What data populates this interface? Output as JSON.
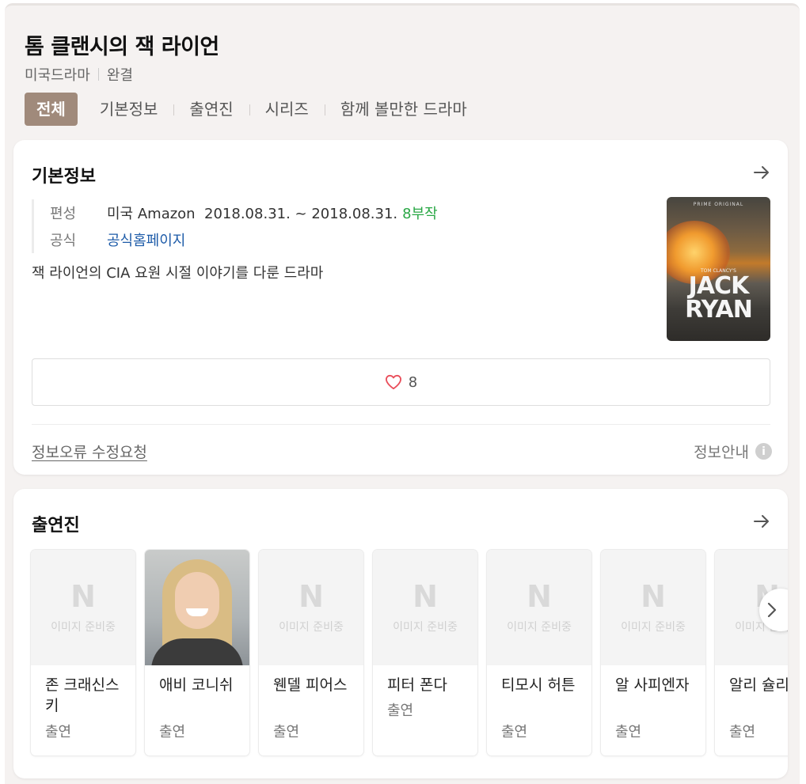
{
  "header": {
    "title": "톰 클랜시의 잭 라이언",
    "genre": "미국드라마",
    "status": "완결"
  },
  "tabs": [
    {
      "label": "전체",
      "active": true
    },
    {
      "label": "기본정보"
    },
    {
      "label": "출연진"
    },
    {
      "label": "시리즈"
    },
    {
      "label": "함께 볼만한 드라마"
    }
  ],
  "basic_info": {
    "title": "기본정보",
    "broadcast_label": "편성",
    "broadcast_value": "미국 Amazon  2018.08.31. ~ 2018.08.31.",
    "episodes": "8부작",
    "official_label": "공식",
    "official_link": "공식홈페이지",
    "description": "잭 라이언의 CIA 요원 시절 이야기를 다룬 드라마",
    "poster": {
      "top_text": "PRIME ORIGINAL",
      "small_text": "TOM CLANCY'S",
      "line1": "JACK",
      "line2": "RYAN"
    },
    "likes": "8",
    "report_link": "정보오류 수정요청",
    "info_guide": "정보안내",
    "info_icon_glyph": "i"
  },
  "cast": {
    "title": "출연진",
    "placeholder_logo": "N",
    "placeholder_text": "이미지 준비중",
    "members": [
      {
        "name": "존 크래신스키",
        "role": "출연"
      },
      {
        "name": "애비 코니쉬",
        "role": "출연"
      },
      {
        "name": "웬델 피어스",
        "role": "출연"
      },
      {
        "name": "피터 폰다",
        "role": "출연"
      },
      {
        "name": "티모시 허튼",
        "role": "출연"
      },
      {
        "name": "알 사피엔자",
        "role": "출연"
      },
      {
        "name": "알리 슐리만",
        "role": "출연"
      }
    ]
  },
  "colors": {
    "active_tab": "#a08a7b",
    "episodes_green": "#29a745",
    "link_blue": "#1d5ba8",
    "heart_red": "#e94d5a"
  },
  "icons": [
    "arrow-right-icon",
    "heart-icon",
    "info-icon",
    "chevron-right-icon"
  ]
}
